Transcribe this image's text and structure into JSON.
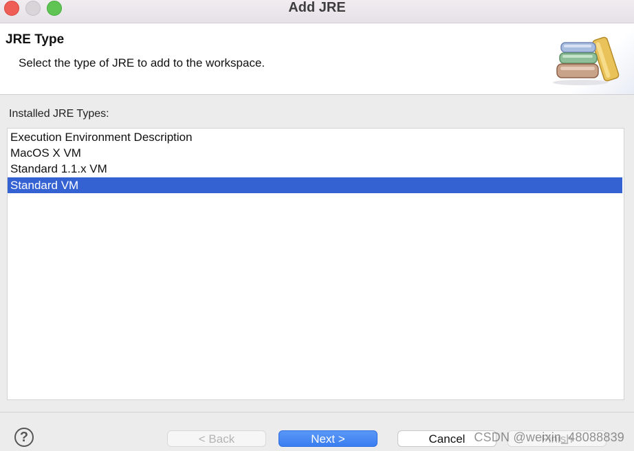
{
  "window": {
    "title": "Add JRE"
  },
  "banner": {
    "title": "JRE Type",
    "description": "Select the type of JRE to add to the workspace.",
    "icon": "library-books-icon"
  },
  "list": {
    "label": "Installed JRE Types:",
    "items": [
      {
        "label": "Execution Environment Description",
        "selected": false
      },
      {
        "label": "MacOS X VM",
        "selected": false
      },
      {
        "label": "Standard 1.1.x VM",
        "selected": false
      },
      {
        "label": "Standard VM",
        "selected": true
      }
    ]
  },
  "footer": {
    "help_icon": "help-icon",
    "help_glyph": "?",
    "back_label": "< Back",
    "next_label": "Next >",
    "cancel_label": "Cancel",
    "finish_label": "Finish"
  },
  "watermark": {
    "text": "CSDN @weixin_48088839"
  },
  "colors": {
    "selection": "#3462d3",
    "primary_button": "#3a7df0",
    "close_button": "#ee5e56",
    "maximize_button": "#5fc453"
  }
}
